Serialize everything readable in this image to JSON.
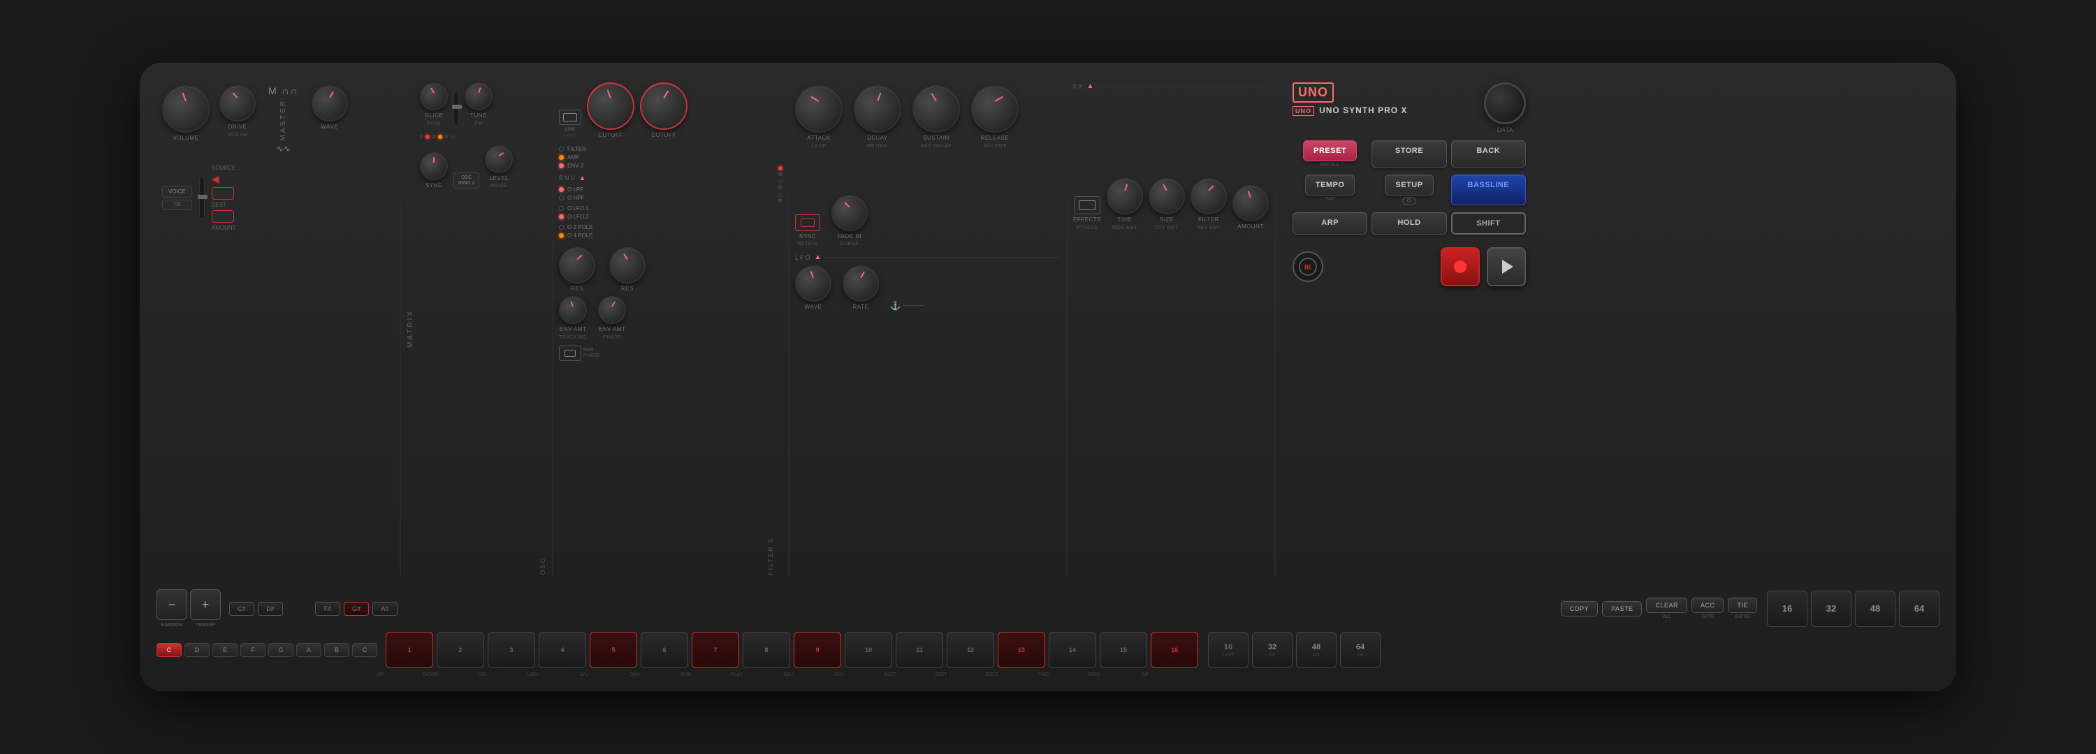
{
  "brand": {
    "logo": "UNO",
    "product_name": "UNO SYNTH PRO X",
    "data_label": "DATA"
  },
  "sections": {
    "master": "MASTER",
    "matrix": "MATRIX",
    "osc": "OSC",
    "filter": "FILTER S",
    "env": "ENV",
    "lfo": "LFO",
    "fx": "FX"
  },
  "knobs": {
    "volume": "VOLUME",
    "drive": "DRIVE",
    "drive_sub": "VCA AM",
    "wave": "WAVE",
    "voice": "VOICE",
    "source": "SOURCE",
    "dest": "DEST",
    "amount": "AMOUNT",
    "glide": "GLIDE",
    "glide_sub": "TYPE",
    "tune": "TUNE",
    "tune_sub": "FM",
    "sync": "SYNC",
    "level": "LEVEL",
    "level_sub": "NOISE",
    "cutoff1": "CUTOFF",
    "cutoff2": "CUTOFF",
    "res1": "RES",
    "res2": "RES",
    "env_amt_tracking": "ENV AMT",
    "env_amt_tracking_sub": "TRACKING",
    "env_amt_phase": "ENV AMT",
    "env_amt_phase_sub": "PHASE",
    "attack": "ATTACK",
    "attack_sub": "LOOP",
    "decay": "DECAY",
    "decay_sub": "RETRIG",
    "sustain": "SUSTAIN",
    "sustain_sub": "ACC DECAY",
    "release": "RELEASE",
    "release_sub": "ACCENT",
    "wave_lfo": "WAVE",
    "rate": "RATE",
    "time": "TIME",
    "time_sub": "MOD AMT",
    "size": "SIZE",
    "size_sub": "DLY AMT",
    "filter_fx": "FILTER",
    "filter_fx_sub": "REV AMT",
    "amount_fx": "AMOUNT",
    "sync_lfo": "SYNC",
    "sync_sub": "RETRIG",
    "fade_in": "FADE IN",
    "fade_in_sub": "CURVE"
  },
  "buttons": {
    "link": "LINK",
    "plus_res": "+ RES",
    "filter_radio": "FILTER",
    "amp_radio": "AMP",
    "env3_radio": "ENV 3",
    "lpf": "O LPF",
    "hpf": "O HPF",
    "o2pole": "O 2 POLE",
    "o4pole": "O 4 POLE",
    "lfo1": "O LFO 1",
    "lfo2": "O LFO 2",
    "effects": "EFFECTS",
    "effects_sub": "BYPASS",
    "preset": "PRESET",
    "preset_sub": "RECALL",
    "store": "STORE",
    "back": "BACK",
    "tempo": "TEMPO",
    "tap": "TAP",
    "setup": "SETUP",
    "bassline": "BASSLINE",
    "arp": "ARP",
    "hold": "HOLD",
    "shift": "SHIFT",
    "power": "⏻",
    "random": "RANDOM",
    "transp": "TRANSP",
    "copy": "COPY",
    "paste": "PASTE",
    "clear": "CLEAR",
    "acc": "ACC",
    "tie": "TIE",
    "all": "ALL",
    "gate": "GATE",
    "swing": "SWING"
  },
  "notes": {
    "sharps": [
      "C#",
      "D#",
      "",
      "F#",
      "G#",
      "A#"
    ],
    "naturals": [
      "C",
      "D",
      "E",
      "F",
      "G",
      "A",
      "B",
      "C"
    ],
    "active_sharp": "G#"
  },
  "steps": {
    "numbers": [
      1,
      2,
      3,
      4,
      5,
      6,
      7,
      8,
      9,
      10,
      11,
      12,
      13,
      14,
      15,
      16
    ],
    "active": [
      1,
      5,
      7,
      9,
      13,
      16
    ],
    "labels": [
      "UP",
      "DOWN",
      "U/D",
      "U/D+",
      "D/U",
      "D/U+",
      "RND",
      "PLAY",
      "X2U",
      "X2D",
      "10CT",
      "20CT",
      "3OCT",
      "FWD",
      "BWD",
      "INF"
    ]
  },
  "patterns": {
    "numbers": [
      16,
      32,
      48,
      64
    ],
    "labels": [
      "LAST",
      "O2",
      "O3",
      "O4"
    ]
  },
  "tie_label": "TIE",
  "misc": {
    "osc_ring": "OSC\nRING 2",
    "env_arrow_up": "▲",
    "lfo_arrow_up": "▲",
    "fx_arrow_up": "▲"
  }
}
